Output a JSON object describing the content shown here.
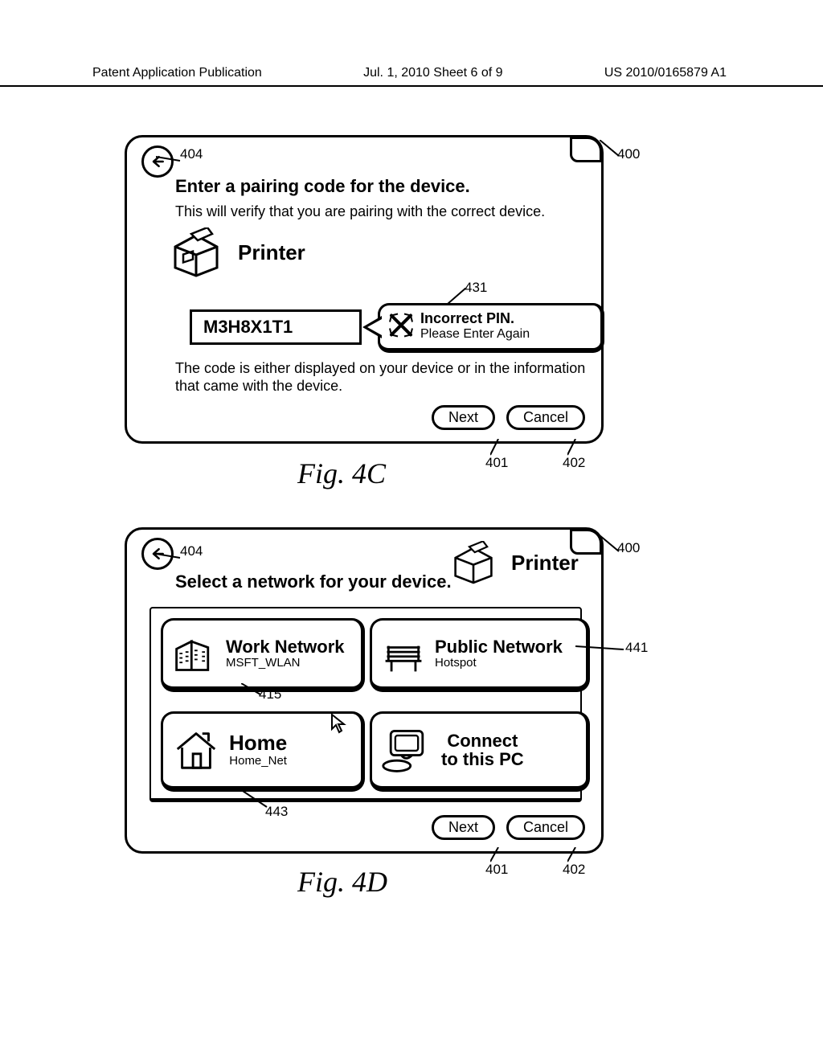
{
  "header": {
    "left": "Patent Application Publication",
    "mid": "Jul. 1, 2010   Sheet 6 of 9",
    "right": "US 2010/0165879 A1"
  },
  "callouts": {
    "c404a": "404",
    "c431": "431",
    "c400a": "400",
    "c401a": "401",
    "c402a": "402",
    "c404b": "404",
    "c400b": "400",
    "c441": "441",
    "c415": "415",
    "c443": "443",
    "c401b": "401",
    "c402b": "402"
  },
  "fig4c": {
    "title": "Enter a pairing code for the device.",
    "subtitle": "This will verify that you are pairing with the correct device.",
    "device_label": "Printer",
    "pin_value": "M3H8X1T1",
    "error_title": "Incorrect PIN.",
    "error_text": "Please Enter Again",
    "help1": "The code is either displayed on your device or in the information",
    "help2": "that came with the device.",
    "next": "Next",
    "cancel": "Cancel",
    "caption": "Fig. 4C"
  },
  "fig4d": {
    "title": "Select a network for your device.",
    "device_label": "Printer",
    "tiles": {
      "work": {
        "label": "Work Network",
        "sub": "MSFT_WLAN"
      },
      "public": {
        "label": "Public Network",
        "sub": "Hotspot"
      },
      "home": {
        "label": "Home",
        "sub": "Home_Net"
      },
      "pc_l1": "Connect",
      "pc_l2": "to this PC"
    },
    "next": "Next",
    "cancel": "Cancel",
    "caption": "Fig. 4D"
  }
}
